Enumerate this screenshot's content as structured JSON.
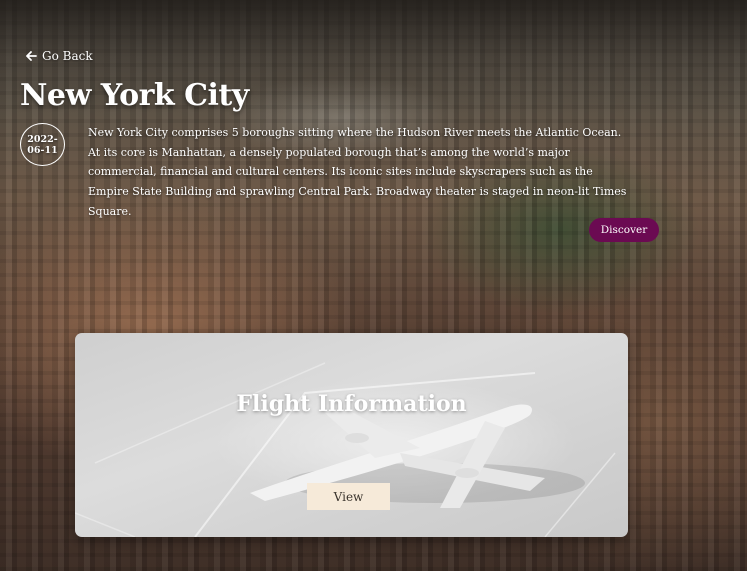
{
  "nav": {
    "back_label": "Go Back",
    "back_icon": "arrow-left-icon"
  },
  "destination": {
    "title": "New York City",
    "date_line1": "2022-",
    "date_line2": "06-11",
    "description": "New York City comprises 5 boroughs sitting where the Hudson River meets the Atlantic Ocean. At its core is Manhattan, a densely populated borough that’s among the world’s major commercial, financial and cultural centers. Its iconic sites include skyscrapers such as the Empire State Building and sprawling Central Park. Broadway theater is staged in neon-lit Times Square.",
    "discover_label": "Discover"
  },
  "flight_card": {
    "title": "Flight Information",
    "view_label": "View"
  },
  "colors": {
    "accent": "#6b0a52",
    "view_button_bg": "#f6ead9",
    "card_bg": "#d6d6d6"
  }
}
